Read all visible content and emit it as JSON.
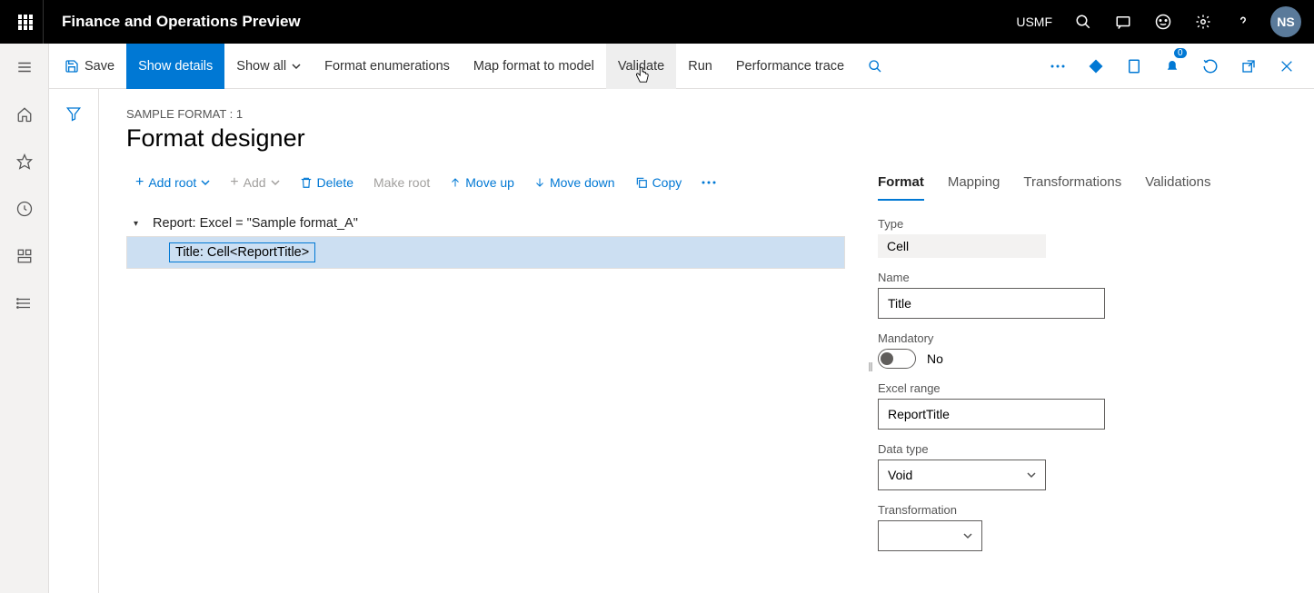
{
  "header": {
    "app_title": "Finance and Operations Preview",
    "company": "USMF",
    "avatar": "NS"
  },
  "cmdbar": {
    "save": "Save",
    "show_details": "Show details",
    "show_all": "Show all",
    "format_enums": "Format enumerations",
    "map_model": "Map format to model",
    "validate": "Validate",
    "run": "Run",
    "perf": "Performance trace",
    "badge": "0"
  },
  "page": {
    "crumb": "SAMPLE FORMAT : 1",
    "title": "Format designer"
  },
  "toolbar": {
    "add_root": "Add root",
    "add": "Add",
    "delete": "Delete",
    "make_root": "Make root",
    "move_up": "Move up",
    "move_down": "Move down",
    "copy": "Copy"
  },
  "tree": {
    "root": "Report: Excel = \"Sample format_A\"",
    "child": "Title: Cell<ReportTitle>"
  },
  "tabs": {
    "format": "Format",
    "mapping": "Mapping",
    "transformations": "Transformations",
    "validations": "Validations"
  },
  "props": {
    "type_label": "Type",
    "type_value": "Cell",
    "name_label": "Name",
    "name_value": "Title",
    "mandatory_label": "Mandatory",
    "mandatory_value": "No",
    "range_label": "Excel range",
    "range_value": "ReportTitle",
    "datatype_label": "Data type",
    "datatype_value": "Void",
    "transformation_label": "Transformation",
    "transformation_value": ""
  }
}
